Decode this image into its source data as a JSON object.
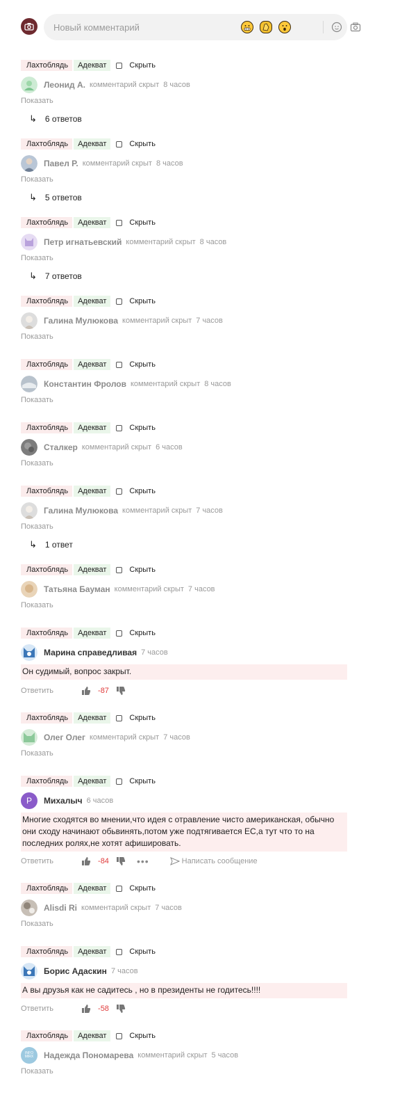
{
  "composer": {
    "placeholder": "Новый комментарий"
  },
  "labels": {
    "bad_tag": "Лахтоблядь",
    "good_tag": "Адекват",
    "hide": "Скрыть",
    "show": "Показать",
    "hidden_note": "комментарий скрыт",
    "reply": "Ответить",
    "send_message": "Написать сообщение"
  },
  "comments": [
    {
      "name": "Леонид А.",
      "time": "8 часов",
      "replies": "6 ответов"
    },
    {
      "name": "Павел Р.",
      "time": "8 часов",
      "replies": "5 ответов"
    },
    {
      "name": "Петр игнатьевский",
      "time": "8 часов",
      "replies": "7 ответов"
    },
    {
      "name": "Галина Мулюкова",
      "time": "7 часов"
    },
    {
      "name": "Константин Фролов",
      "time": "8 часов"
    },
    {
      "name": "Сталкер",
      "time": "6 часов"
    },
    {
      "name": "Галина Мулюкова",
      "time": "7 часов",
      "replies": "1 ответ"
    },
    {
      "name": "Татьяна Бауман",
      "time": "7 часов"
    },
    {
      "name": "Марина справедливая",
      "time": "7 часов",
      "text": "Он судимый, вопрос закрыт.",
      "score": "-87"
    },
    {
      "name": "Олег Олег",
      "time": "7 часов"
    },
    {
      "name": "Михалыч",
      "time": "6 часов",
      "avatar_letter": "Р",
      "text": "Многие сходятся во мнении,что идея с отравление чисто американская, обычно они сходу начинают обьвинять,потом уже подтягивается ЕС,а тут что то на последних ролях,не хотят афишировать.",
      "score": "-84"
    },
    {
      "name": "Alisdi Ri",
      "time": "7 часов"
    },
    {
      "name": "Борис Адаскин",
      "time": "7 часов",
      "text": "А вы друзья как не садитесь , но в президенты не годитесь!!!!",
      "score": "-58"
    },
    {
      "name": "Надежда Пономарева",
      "time": "5 часов",
      "avatar_text": "INFO MIRX"
    }
  ],
  "colors": {
    "score_negative": "#e03b3b",
    "bad_tag_bg": "#fbecec",
    "good_tag_bg": "#eaf6ea",
    "body_bg": "#fdeeee"
  }
}
